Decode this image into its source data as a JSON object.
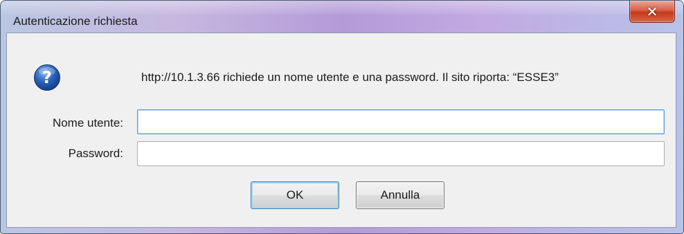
{
  "window": {
    "title": "Autenticazione richiesta",
    "close_icon": "close-icon"
  },
  "dialog": {
    "icon": "question-icon",
    "message": "http://10.1.3.66 richiede un nome utente e una password. Il sito riporta: “ESSE3”",
    "username_label": "Nome utente:",
    "username_value": "",
    "password_label": "Password:",
    "password_value": "",
    "ok_label": "OK",
    "cancel_label": "Annulla"
  },
  "colors": {
    "title_gradient_accent": "#b49bd8",
    "close_button": "#c4371e",
    "client_background": "#f0f0f0",
    "icon_blue": "#2a62b8",
    "focus_border": "#5e9bd6"
  }
}
